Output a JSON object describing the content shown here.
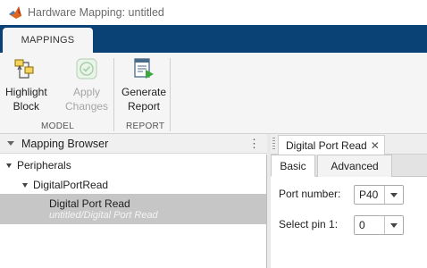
{
  "window": {
    "title": "Hardware Mapping: untitled",
    "logo_icon": "matlab-membrane-logo"
  },
  "ribbon": {
    "tabs": [
      {
        "label": "MAPPINGS",
        "active": true
      }
    ],
    "groups": {
      "model": {
        "label": "MODEL",
        "buttons": {
          "highlight": {
            "line1": "Highlight",
            "line2": "Block",
            "icon": "highlight-block-icon",
            "enabled": true
          },
          "apply": {
            "line1": "Apply",
            "line2": "Changes",
            "icon": "apply-changes-icon",
            "enabled": false
          }
        }
      },
      "report": {
        "label": "REPORT",
        "buttons": {
          "generate": {
            "line1": "Generate",
            "line2": "Report",
            "icon": "generate-report-icon",
            "enabled": true
          }
        }
      }
    }
  },
  "browser": {
    "title": "Mapping Browser",
    "menu_icon": "kebab-menu-icon",
    "tree": {
      "root": "Peripherals",
      "child": "DigitalPortRead",
      "leaf_name": "Digital Port Read",
      "leaf_path": "untitled/Digital Port Read"
    }
  },
  "document": {
    "tab_title": "Digital Port Read",
    "close_symbol": "✕",
    "inner_tabs": {
      "basic": "Basic",
      "advanced": "Advanced"
    },
    "fields": {
      "port": {
        "label": "Port number:",
        "value": "P40"
      },
      "pin": {
        "label": "Select pin 1:",
        "value": "0"
      }
    }
  },
  "colors": {
    "ribbon_blue": "#0b4275",
    "toolstrip_bg": "#f5f5f5",
    "selection_gray": "#c6c6c6",
    "disabled_text": "#a5a5a5"
  }
}
